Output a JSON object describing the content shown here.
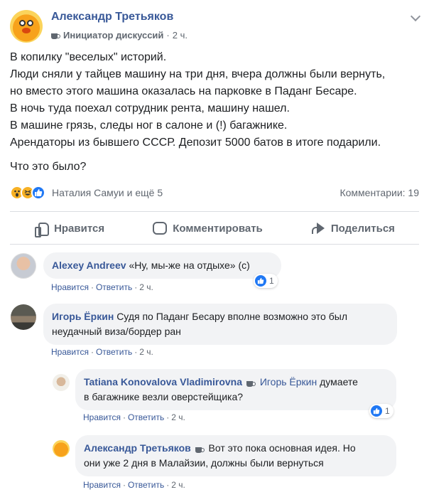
{
  "post": {
    "author": "Александр Третьяков",
    "role_badge": "Инициатор дискуссий",
    "time_sep": "·",
    "time": "2 ч.",
    "body_lines": [
      "В копилку \"веселых\" историй.",
      "Люди сняли у тайцев машину на три дня, вчера должны были вернуть,",
      "но вместо этого машина оказалась на парковке в Паданг Бесаре.",
      "В ночь туда поехал сотрудник рента, машину нашел.",
      "В машине грязь, следы ног в салоне и (!) багажнике.",
      "Арендаторы из бывшего СССР. Депозит 5000 батов в итоге подарили."
    ],
    "question": "Что это было?",
    "reactions_names": "Наталия Самуи и ещё 5",
    "comments_count": "Комментарии: 19",
    "reaction_icons": [
      "wow-icon",
      "haha-icon",
      "like-icon"
    ]
  },
  "actions": {
    "like": "Нравится",
    "comment": "Комментировать",
    "share": "Поделиться"
  },
  "comments": [
    {
      "author": "Alexey Andreev",
      "text": "«Ну, мы-же на отдыхе» (с)",
      "like_label": "Нравится",
      "reply_label": "Ответить",
      "time": "2 ч.",
      "likes": "1"
    },
    {
      "author": "Игорь Ёркин",
      "text_line1": "Судя по Паданг Бесару вполне возможно это был",
      "text_line2": "неудачный виза/бордер ран",
      "like_label": "Нравится",
      "reply_label": "Ответить",
      "time": "2 ч."
    }
  ],
  "replies": [
    {
      "author": "Tatiana Konovalova Vladimirovna",
      "mention": "Игорь Ёркин",
      "text_line1": "думаете",
      "text_line2": "в багажнике везли оверстейщика?",
      "like_label": "Нравится",
      "reply_label": "Ответить",
      "time": "2 ч.",
      "likes": "1"
    },
    {
      "author": "Александр Третьяков",
      "text_line1": "Вот это пока основная идея. Но",
      "text_line2": "они уже 2 дня в Малайзии, должны были вернуться",
      "like_label": "Нравится",
      "reply_label": "Ответить",
      "time": "2 ч."
    }
  ],
  "colors": {
    "link_blue": "#385898",
    "meta_gray": "#606770",
    "bubble_bg": "#f2f3f5",
    "like_blue": "#2078f4",
    "reaction_yellow": "#f7b125"
  }
}
